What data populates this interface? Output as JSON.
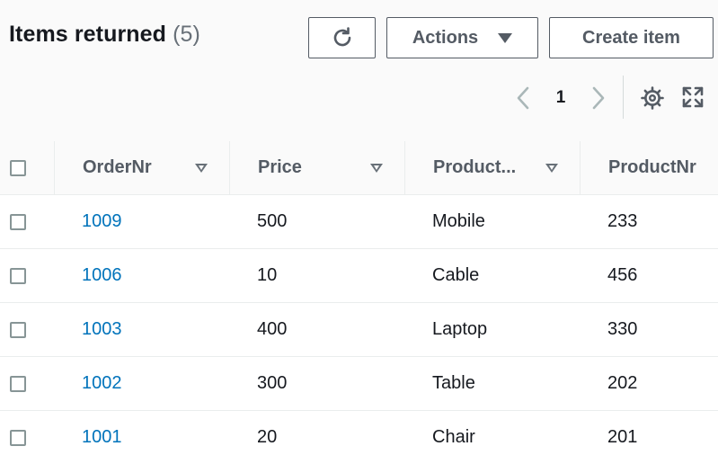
{
  "header": {
    "title": "Items returned",
    "count": "(5)"
  },
  "toolbar": {
    "refresh_icon": "refresh-icon",
    "actions_label": "Actions",
    "create_label": "Create item"
  },
  "pagination": {
    "current_page": "1",
    "prev_icon": "chevron-left-icon",
    "next_icon": "chevron-right-icon"
  },
  "icons": {
    "settings": "gear-icon",
    "fullscreen": "expand-icon"
  },
  "colors": {
    "link": "#0073bb",
    "text": "#16191f",
    "muted": "#687078",
    "border": "#545b64"
  },
  "table": {
    "columns": [
      "OrderNr",
      "Price",
      "Product...",
      "ProductNr"
    ],
    "rows": [
      {
        "order": "1009",
        "price": "500",
        "product": "Mobile",
        "product_nr": "233"
      },
      {
        "order": "1006",
        "price": "10",
        "product": "Cable",
        "product_nr": "456"
      },
      {
        "order": "1003",
        "price": "400",
        "product": "Laptop",
        "product_nr": "330"
      },
      {
        "order": "1002",
        "price": "300",
        "product": "Table",
        "product_nr": "202"
      },
      {
        "order": "1001",
        "price": "20",
        "product": "Chair",
        "product_nr": "201"
      }
    ]
  }
}
